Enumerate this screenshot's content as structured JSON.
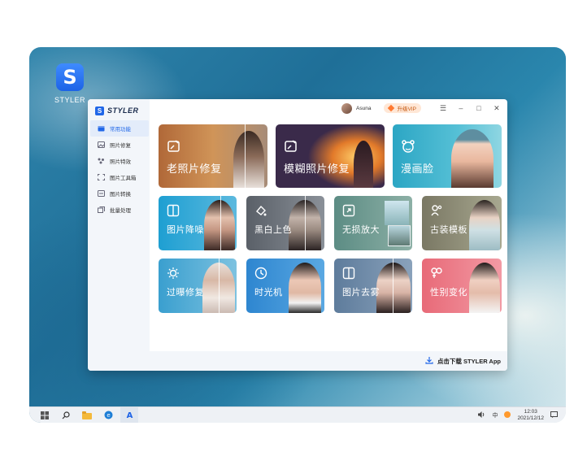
{
  "desktop": {
    "icon_label": "STYLER",
    "icon_glyph": "S"
  },
  "app": {
    "brand": "STYLER",
    "brand_glyph": "S",
    "user_name": "Asuna",
    "vip_label": "升级VIP",
    "window_controls": [
      "☰",
      "–",
      "□",
      "✕"
    ],
    "sidebar": [
      {
        "label": "常用功能",
        "icon": "home-icon",
        "active": true
      },
      {
        "label": "照片修复",
        "icon": "photo-icon",
        "active": false
      },
      {
        "label": "照片特效",
        "icon": "sparkle-icon",
        "active": false
      },
      {
        "label": "图片工具箱",
        "icon": "toolbox-icon",
        "active": false
      },
      {
        "label": "图片转换",
        "icon": "convert-icon",
        "active": false
      },
      {
        "label": "批量处理",
        "icon": "batch-icon",
        "active": false
      }
    ],
    "cards": [
      {
        "title": "老照片修复",
        "icon": "restore-icon"
      },
      {
        "title": "模糊照片修复",
        "icon": "deblur-icon"
      },
      {
        "title": "漫画脸",
        "icon": "cartoon-icon"
      },
      {
        "title": "图片降噪",
        "icon": "denoise-icon"
      },
      {
        "title": "黑白上色",
        "icon": "colorize-icon"
      },
      {
        "title": "无损放大",
        "icon": "upscale-icon"
      },
      {
        "title": "古装模板",
        "icon": "costume-icon"
      },
      {
        "title": "过曝修复",
        "icon": "exposure-icon"
      },
      {
        "title": "时光机",
        "icon": "clock-icon"
      },
      {
        "title": "图片去雾",
        "icon": "dehaze-icon"
      },
      {
        "title": "性别变化",
        "icon": "gender-icon"
      }
    ],
    "footer_label": "点击下载 STYLER App"
  },
  "taskbar": {
    "ime": "中",
    "time": "12:03",
    "date": "2021/12/12"
  },
  "colors": {
    "accent": "#2167e8",
    "vip_bg": "#ffe7d6",
    "vip_text": "#c4560d"
  }
}
